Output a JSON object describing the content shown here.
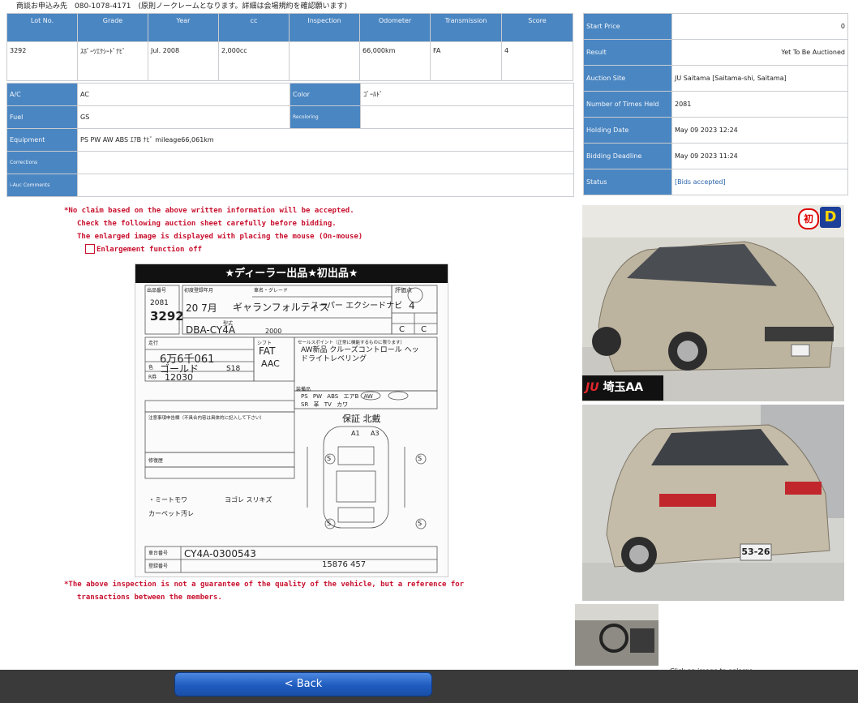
{
  "contact_note": "商談お申込み先　080-1078-4171　(原則ノークレームとなります。詳細は会場規約を確認願います)",
  "lot": {
    "headers": [
      "Lot No.",
      "Grade",
      "Year",
      "cc",
      "Inspection",
      "Odometer",
      "Transmission",
      "Score"
    ],
    "values": [
      "3292",
      "ｽﾎﾟｰﾂｴｸｼｰﾄﾞﾅﾋﾞ",
      "Jul. 2008",
      "2,000cc",
      "",
      "66,000km",
      "FA",
      "4"
    ]
  },
  "specs": {
    "ac_label": "A/C",
    "ac_value": "AC",
    "color_label": "Color",
    "color_value": "ｺﾞｰﾙﾄﾞ",
    "fuel_label": "Fuel",
    "fuel_value": "GS",
    "recoloring_label": "Recoloring",
    "recoloring_value": "",
    "equipment_label": "Equipment",
    "equipment_value": "PS PW AW ABS ｴｱB ﾅﾋﾞ mileage66,061km",
    "corrections_label": "Corrections",
    "corrections_value": "",
    "comments_label": "i-Auc Comments",
    "comments_value": ""
  },
  "info": {
    "start_price_label": "Start Price",
    "start_price_value": "0",
    "result_label": "Result",
    "result_value": "Yet To Be Auctioned",
    "site_label": "Auction Site",
    "site_value": "JU Saitama [Saitama-shi, Saitama]",
    "times_label": "Number of Times Held",
    "times_value": "2081",
    "holding_label": "Holding Date",
    "holding_value": "May 09 2023 12:24",
    "deadline_label": "Bidding Deadline",
    "deadline_value": "May 09 2023 11:24",
    "status_label": "Status",
    "status_value": "[Bids accepted]"
  },
  "notices": {
    "line1": "*No claim based on the above written information will be accepted.",
    "line2": "Check the following auction sheet carefully before bidding.",
    "line3": "The enlarged image is displayed with placing the mouse (On-mouse)",
    "enlarge_label": "Enlargement function off",
    "line4": "*The above inspection is not a guarantee of the quality of the vehicle, but a reference for",
    "line5": "transactions between the members."
  },
  "sheet": {
    "title": "★ディーラー出品★初出品★",
    "lot_no": "3292",
    "times": "2081",
    "model": "DBA-CY4A",
    "year": "20 7月",
    "name": "ギャランフォルティス",
    "grade": "スーパー エクシードナビ",
    "score": "4",
    "interior": "C",
    "exterior": "C",
    "mileage": "6万6千061",
    "color": "ゴールド",
    "color_code": "S18",
    "shift": "FAT",
    "ac": "AAC",
    "tax": "12030",
    "sales_points": "AW新品 クルーズコントロール ヘッドライトレベリング",
    "owner": "保証 北戴",
    "chassis": "CY4A-0300543",
    "reg": "15876 457",
    "cc": "2000",
    "lbl_lot": "出品番号",
    "lbl_year": "初度登録年月",
    "lbl_name": "車名・グレード",
    "lbl_score": "評価点",
    "lbl_type": "型式",
    "lbl_shift": "シフト",
    "lbl_color": "色",
    "lbl_mile": "走行",
    "lbl_tax": "R券",
    "lbl_sales": "セールスポイント（正常に機能するものに限ります）",
    "lbl_equip": "装備品",
    "lbl_notice": "注意事項申告欄（不具合内容は具体的に記入して下さい）",
    "lbl_repair": "修復歴",
    "lbl_chassis": "車台番号",
    "lbl_reg": "登録番号",
    "equip": [
      "PS",
      "PW",
      "ABS",
      "エアB",
      "AW",
      "SR",
      "革",
      "TV",
      "カワ"
    ],
    "diagram_marks": [
      "A1",
      "A3",
      "S",
      "S",
      "S",
      "S"
    ],
    "notes": [
      "・ミートモワ",
      "カーペット汚レ",
      "ヨゴレ スリキズ"
    ]
  },
  "photos": {
    "badge_first": "初",
    "badge_d": "D",
    "brand_logo": "JU",
    "site_text": "埼玉AA",
    "plate": "53-26"
  },
  "enlarge_note": "Click an image to enlarge.",
  "back_label": "< Back"
}
